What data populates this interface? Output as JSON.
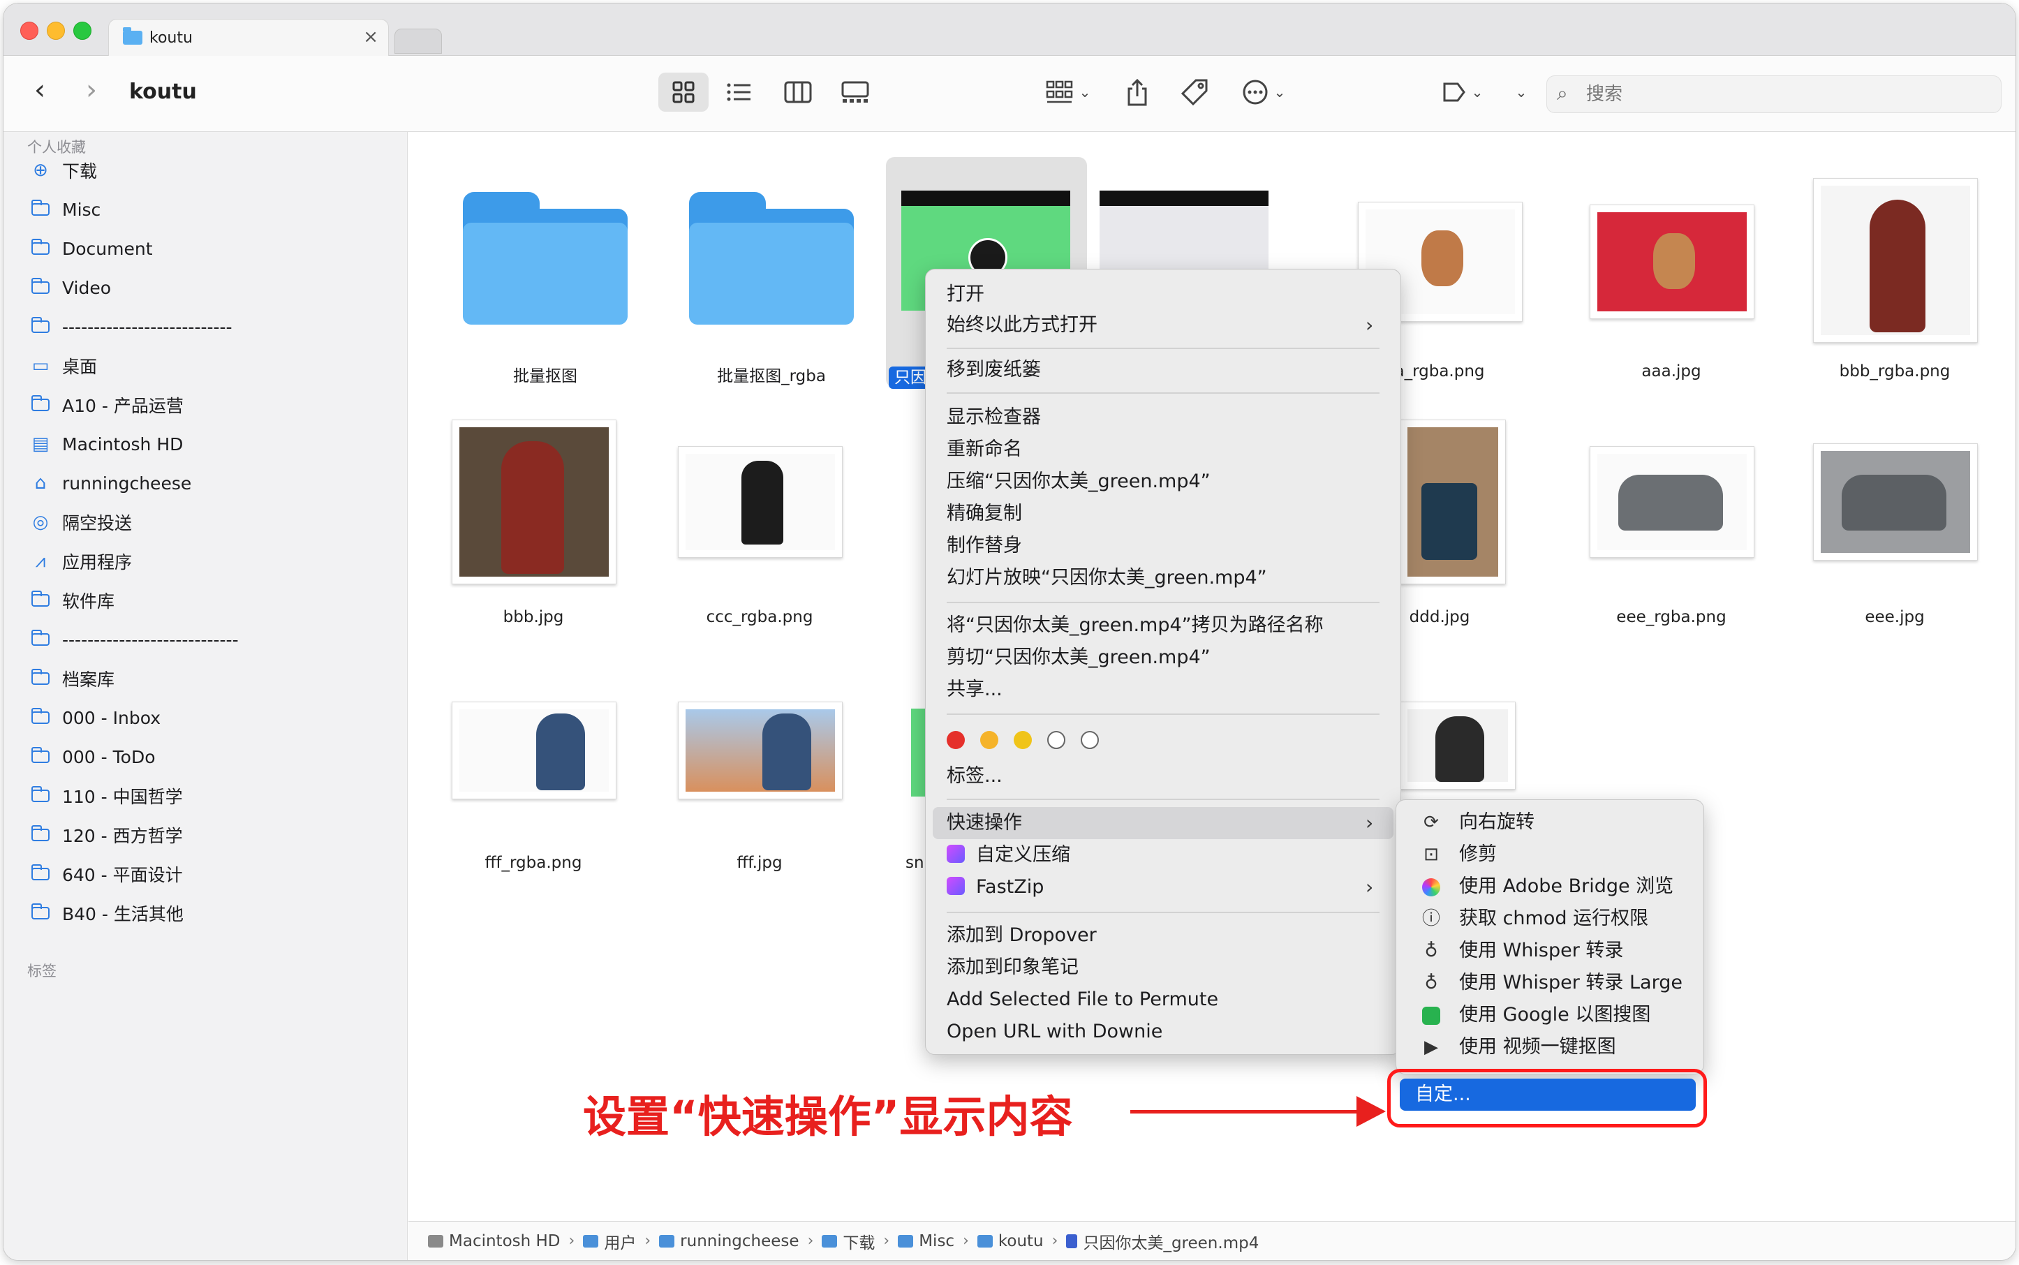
{
  "tab": {
    "title": "koutu",
    "close": "×"
  },
  "toolbar": {
    "title": "koutu",
    "search_placeholder": "搜索"
  },
  "sidebar": {
    "section_favorites": "个人收藏",
    "items": [
      {
        "label": "下载",
        "icon": "download-icon"
      },
      {
        "label": "Misc",
        "icon": "folder-icon"
      },
      {
        "label": "Document",
        "icon": "folder-icon"
      },
      {
        "label": "Video",
        "icon": "folder-icon"
      },
      {
        "label": "---------------------------",
        "icon": "folder-icon"
      },
      {
        "label": "桌面",
        "icon": "desktop-icon"
      },
      {
        "label": "A10 - 产品运营",
        "icon": "folder-icon"
      },
      {
        "label": "Macintosh HD",
        "icon": "disk-icon"
      },
      {
        "label": "runningcheese",
        "icon": "home-icon"
      },
      {
        "label": "隔空投送",
        "icon": "airdrop-icon"
      },
      {
        "label": "应用程序",
        "icon": "apps-icon"
      },
      {
        "label": "软件库",
        "icon": "folder-icon"
      },
      {
        "label": "----------------------------",
        "icon": "folder-icon"
      },
      {
        "label": "档案库",
        "icon": "folder-icon"
      },
      {
        "label": "000 - Inbox",
        "icon": "folder-icon"
      },
      {
        "label": "000 - ToDo",
        "icon": "folder-icon"
      },
      {
        "label": "110 - 中国哲学",
        "icon": "folder-icon"
      },
      {
        "label": "120 - 西方哲学",
        "icon": "folder-icon"
      },
      {
        "label": "640 - 平面设计",
        "icon": "folder-icon"
      },
      {
        "label": "B40 - 生活其他",
        "icon": "folder-icon"
      }
    ],
    "section_tags": "标签"
  },
  "files": [
    {
      "name": "批量抠图"
    },
    {
      "name": "批量抠图_rgba"
    },
    {
      "name": "只因"
    },
    {
      "name": ""
    },
    {
      "name": "a_rgba.png"
    },
    {
      "name": "aaa.jpg"
    },
    {
      "name": "bbb_rgba.png"
    },
    {
      "name": "bbb.jpg"
    },
    {
      "name": "ccc_rgba.png"
    },
    {
      "name": "ddd.jpg"
    },
    {
      "name": "eee_rgba.png"
    },
    {
      "name": "eee.jpg"
    },
    {
      "name": "fff_rgba.png"
    },
    {
      "name": "fff.jpg"
    },
    {
      "name": "sn"
    }
  ],
  "menu": {
    "open": "打开",
    "open_with": "始终以此方式打开",
    "trash": "移到废纸篓",
    "inspector": "显示检查器",
    "rename": "重新命名",
    "compress": "压缩“只因你太美_green.mp4”",
    "duplicate": "精确复制",
    "alias": "制作替身",
    "slideshow": "幻灯片放映“只因你太美_green.mp4”",
    "copy_path": "将“只因你太美_green.mp4”拷贝为路径名称",
    "cut": "剪切“只因你太美_green.mp4”",
    "share": "共享...",
    "tags": "标签...",
    "quick_actions": "快速操作",
    "custom_compress": "自定义压缩",
    "fastzip": "FastZip",
    "dropover": "添加到 Dropover",
    "evernote": "添加到印象笔记",
    "permute": "Add Selected File to Permute",
    "downie": "Open URL with Downie",
    "tag_colors": [
      "#e5302b",
      "#f5b32a",
      "#f0c419",
      "#ffffff",
      "#ffffff"
    ]
  },
  "submenu": {
    "items": [
      {
        "label": "向右旋转",
        "icon": "rotate-icon"
      },
      {
        "label": "修剪",
        "icon": "trim-icon"
      },
      {
        "label": "使用 Adobe Bridge 浏览",
        "icon": "adobe-bridge-icon"
      },
      {
        "label": "获取 chmod 运行权限",
        "icon": "info-icon"
      },
      {
        "label": "使用 Whisper 转录",
        "icon": "mic-icon"
      },
      {
        "label": "使用 Whisper 转录 Large",
        "icon": "mic-icon"
      },
      {
        "label": "使用 Google 以图搜图",
        "icon": "image-search-icon"
      },
      {
        "label": "使用 视频一键抠图",
        "icon": "play-icon"
      }
    ],
    "customize": "自定..."
  },
  "annotation": {
    "text": "设置“快速操作”显示内容"
  },
  "pathbar": [
    {
      "label": "Macintosh HD"
    },
    {
      "label": "用户"
    },
    {
      "label": "runningcheese"
    },
    {
      "label": "下载"
    },
    {
      "label": "Misc"
    },
    {
      "label": "koutu"
    },
    {
      "label": "只因你太美_green.mp4"
    }
  ]
}
